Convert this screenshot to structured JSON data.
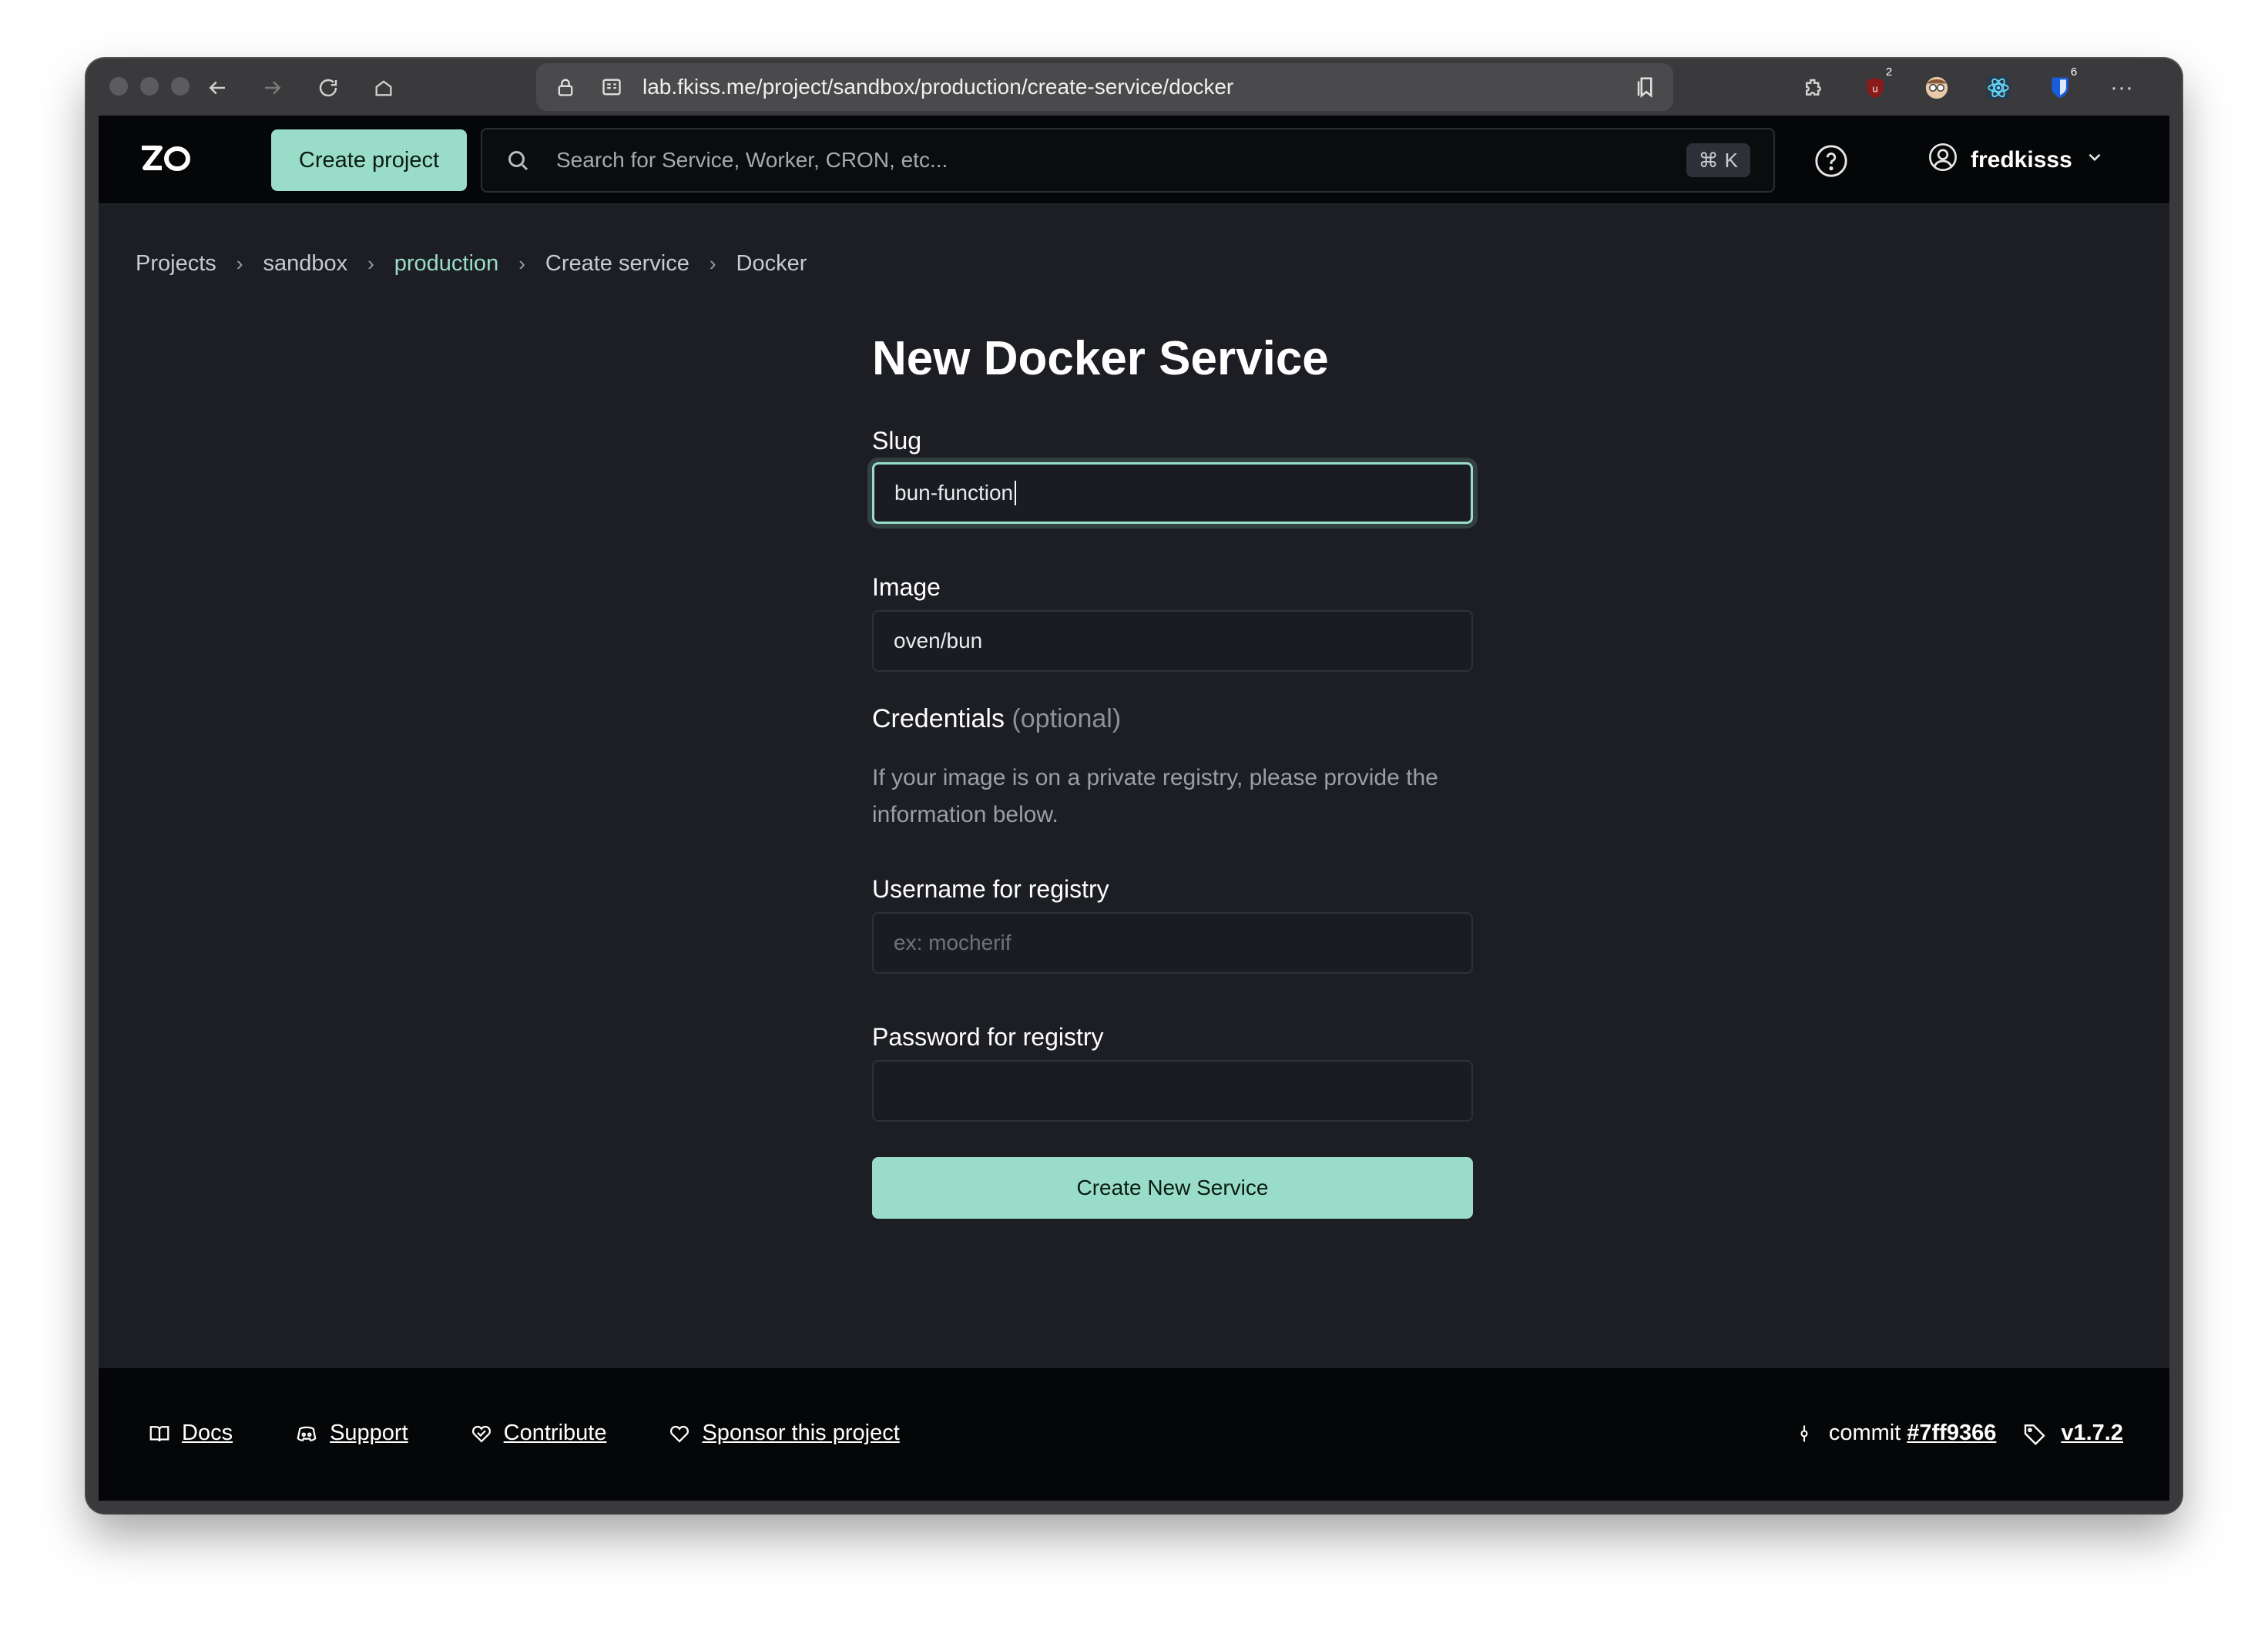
{
  "browser": {
    "url": "lab.fkiss.me/project/sandbox/production/create-service/docker",
    "extensions": [
      {
        "name": "puzzle-icon"
      },
      {
        "name": "ublock-icon",
        "badge": "2"
      },
      {
        "name": "avatar-extension-icon"
      },
      {
        "name": "react-devtools-icon"
      },
      {
        "name": "bitwarden-icon",
        "badge": "6"
      }
    ]
  },
  "header": {
    "create_project_label": "Create project",
    "search_placeholder": "Search for Service, Worker, CRON, etc...",
    "shortcut_symbol": "⌘",
    "shortcut_key": "K",
    "username": "fredkisss"
  },
  "breadcrumb": {
    "items": [
      "Projects",
      "sandbox",
      "production",
      "Create service",
      "Docker"
    ]
  },
  "form": {
    "title": "New Docker Service",
    "slug_label": "Slug",
    "slug_value": "bun-function",
    "image_label": "Image",
    "image_value": "oven/bun",
    "credentials_title": "Credentials",
    "credentials_optional": "(optional)",
    "credentials_description": "If your image is on a private registry, please provide the information below.",
    "username_label": "Username for registry",
    "username_placeholder": "ex: mocherif",
    "password_label": "Password for registry",
    "password_value": "",
    "submit_label": "Create New Service"
  },
  "footer": {
    "links": [
      "Docs",
      "Support",
      "Contribute",
      "Sponsor this project"
    ],
    "commit_label": "commit",
    "commit_hash": "#7ff9366",
    "version": "v1.7.2"
  },
  "colors": {
    "accent": "#99ddc8",
    "background": "#1c1e24",
    "header_bg": "#050607"
  }
}
